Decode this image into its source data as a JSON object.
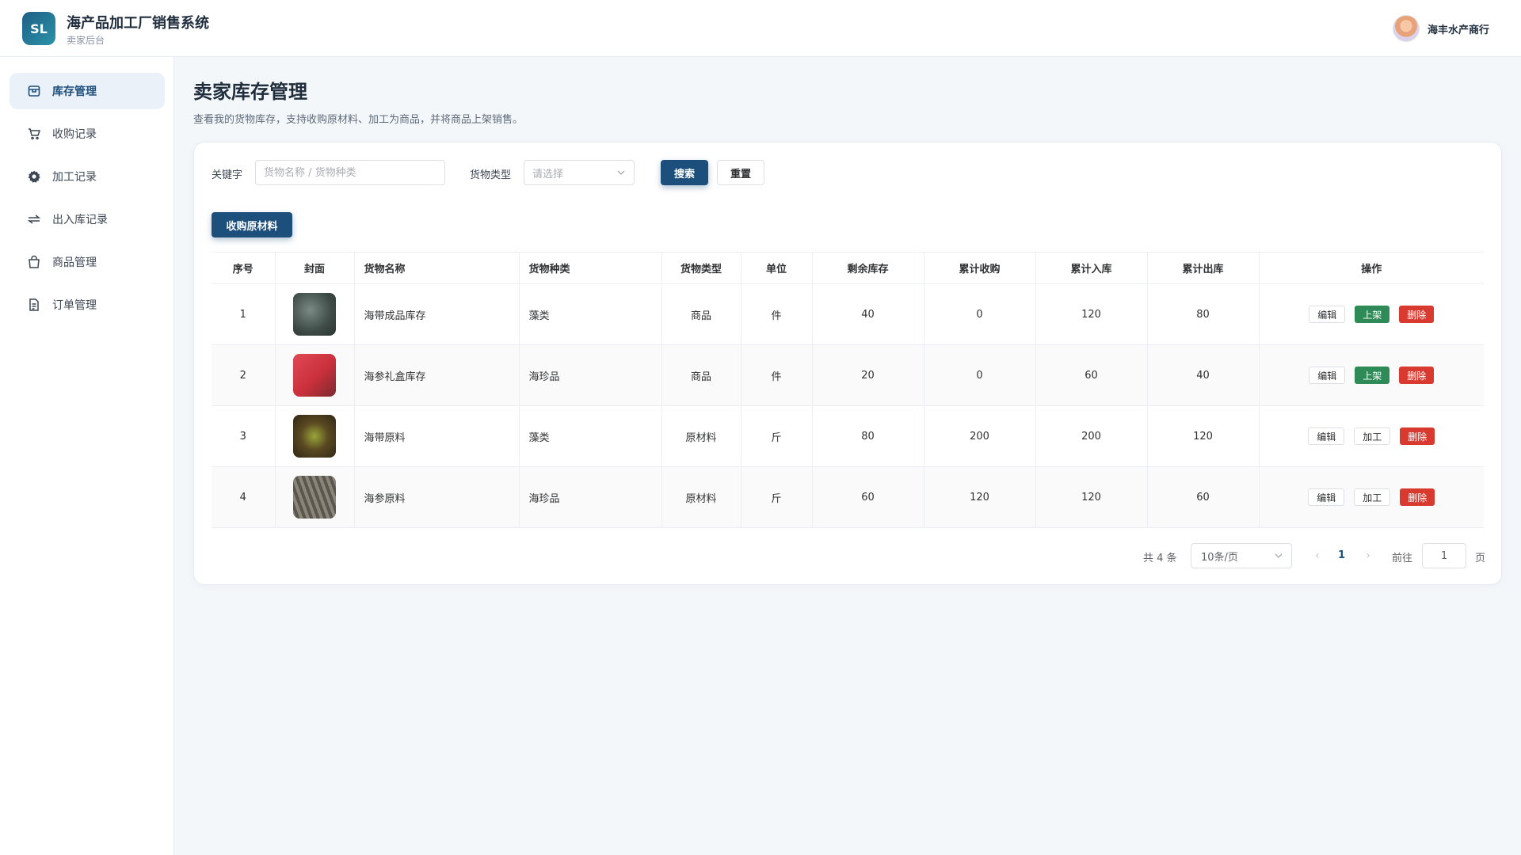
{
  "header": {
    "logo_text": "SL",
    "title": "海产品加工厂销售系统",
    "subtitle": "卖家后台",
    "user_name": "海丰水产商行"
  },
  "sidebar": {
    "items": [
      {
        "label": "库存管理",
        "icon": "box-icon",
        "active": true
      },
      {
        "label": "收购记录",
        "icon": "cart-icon",
        "active": false
      },
      {
        "label": "加工记录",
        "icon": "gear-icon",
        "active": false
      },
      {
        "label": "出入库记录",
        "icon": "transfer-icon",
        "active": false
      },
      {
        "label": "商品管理",
        "icon": "bag-icon",
        "active": false
      },
      {
        "label": "订单管理",
        "icon": "document-icon",
        "active": false
      }
    ]
  },
  "main": {
    "title": "卖家库存管理",
    "description": "查看我的货物库存，支持收购原材料、加工为商品，并将商品上架销售。"
  },
  "filters": {
    "keyword_label": "关键字",
    "keyword_placeholder": "货物名称 / 货物种类",
    "type_label": "货物类型",
    "type_placeholder": "请选择",
    "search_label": "搜索",
    "reset_label": "重置"
  },
  "actions": {
    "purchase_label": "收购原材料"
  },
  "table": {
    "columns": [
      "序号",
      "封面",
      "货物名称",
      "货物种类",
      "货物类型",
      "单位",
      "剩余库存",
      "累计收购",
      "累计入库",
      "累计出库",
      "操作"
    ],
    "rows": [
      {
        "index": "1",
        "name": "海带成品库存",
        "category": "藻类",
        "type": "商品",
        "unit": "件",
        "stock": "40",
        "purchased": "0",
        "in": "120",
        "out": "80",
        "ops": [
          "编辑",
          "上架",
          "删除"
        ],
        "cover_color": "#4a5a55"
      },
      {
        "index": "2",
        "name": "海参礼盒库存",
        "category": "海珍品",
        "type": "商品",
        "unit": "件",
        "stock": "20",
        "purchased": "0",
        "in": "60",
        "out": "40",
        "ops": [
          "编辑",
          "上架",
          "删除"
        ],
        "cover_color": "#d64048"
      },
      {
        "index": "3",
        "name": "海带原料",
        "category": "藻类",
        "type": "原材料",
        "unit": "斤",
        "stock": "80",
        "purchased": "200",
        "in": "200",
        "out": "120",
        "ops": [
          "编辑",
          "加工",
          "删除"
        ],
        "cover_color": "#5b4a22"
      },
      {
        "index": "4",
        "name": "海参原料",
        "category": "海珍品",
        "type": "原材料",
        "unit": "斤",
        "stock": "60",
        "purchased": "120",
        "in": "120",
        "out": "60",
        "ops": [
          "编辑",
          "加工",
          "删除"
        ],
        "cover_color": "#6e6a62"
      }
    ]
  },
  "pagination": {
    "total": "共 4 条",
    "page_size": "10条/页",
    "current_page": "1",
    "goto_label": "前往",
    "goto_value": "1",
    "page_unit": "页"
  },
  "colors": {
    "primary": "#1d4f7c",
    "success": "#2e8b57",
    "danger": "#d93a30"
  }
}
